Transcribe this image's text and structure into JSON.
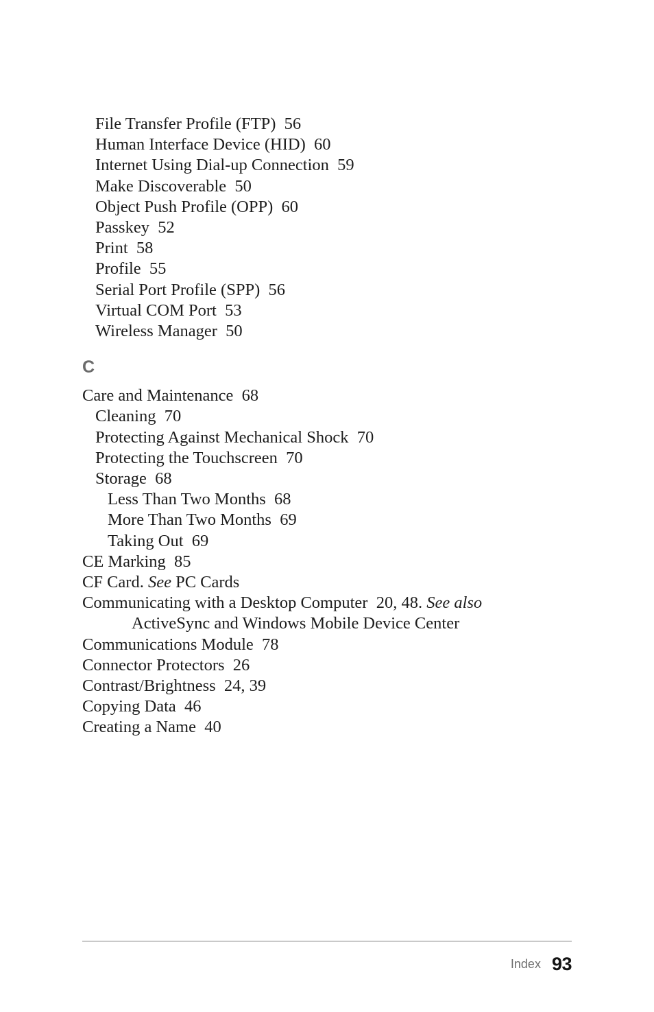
{
  "document": {
    "type": "book-index-page",
    "section_letter": "C",
    "footer": {
      "label": "Index",
      "page_number": "93"
    },
    "colors": {
      "text": "#1d1d1d",
      "letter_heading": "#6b6b6b",
      "footer_label": "#6e6e6e",
      "footer_rule": "#c9c9c9",
      "page_background": "#ffffff"
    }
  },
  "entries_before_heading": [
    {
      "text": "File Transfer Profile (FTP)  56",
      "level": 1
    },
    {
      "text": "Human Interface Device (HID)  60",
      "level": 1
    },
    {
      "text": "Internet Using Dial-up Connection  59",
      "level": 1
    },
    {
      "text": "Make Discoverable  50",
      "level": 1
    },
    {
      "text": "Object Push Profile (OPP)  60",
      "level": 1
    },
    {
      "text": "Passkey  52",
      "level": 1
    },
    {
      "text": "Print  58",
      "level": 1
    },
    {
      "text": "Profile  55",
      "level": 1
    },
    {
      "text": "Serial Port Profile (SPP)  56",
      "level": 1
    },
    {
      "text": "Virtual COM Port  53",
      "level": 1
    },
    {
      "text": "Wireless Manager  50",
      "level": 1
    }
  ],
  "entries_after_heading": [
    {
      "text": "Care and Maintenance  68",
      "level": 0
    },
    {
      "text": "Cleaning  70",
      "level": 1
    },
    {
      "text": "Protecting Against Mechanical Shock  70",
      "level": 1
    },
    {
      "text": "Protecting the Touchscreen  70",
      "level": 1
    },
    {
      "text": "Storage  68",
      "level": 1
    },
    {
      "text": "Less Than Two Months  68",
      "level": 2
    },
    {
      "text": "More Than Two Months  69",
      "level": 2
    },
    {
      "text": "Taking Out  69",
      "level": 2
    },
    {
      "text": "CE Marking  85",
      "level": 0
    },
    {
      "text": "CF Card. ",
      "italic": "See",
      "text_after": " PC Cards",
      "level": 0
    },
    {
      "text": "Communicating with a Desktop Computer  20, 48. ",
      "italic": "See also",
      "continuation": "ActiveSync and Windows Mobile Device Center",
      "level": 0
    },
    {
      "text": "Communications Module  78",
      "level": 0
    },
    {
      "text": "Connector Protectors  26",
      "level": 0
    },
    {
      "text": "Contrast/Brightness  24, 39",
      "level": 0
    },
    {
      "text": "Copying Data  46",
      "level": 0
    },
    {
      "text": "Creating a Name  40",
      "level": 0
    }
  ]
}
